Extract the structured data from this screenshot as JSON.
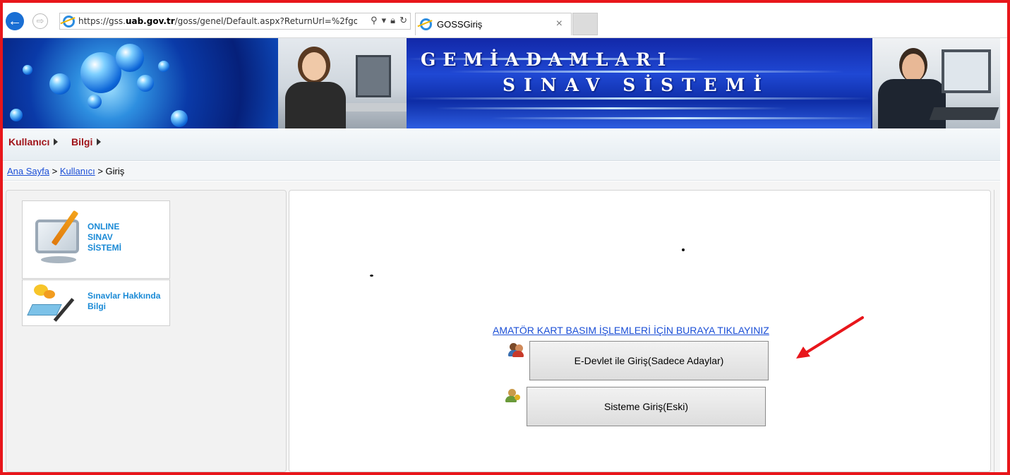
{
  "browser": {
    "url_prefix": "https://gss.",
    "url_domain": "uab.gov.tr",
    "url_suffix": "/goss/genel/Default.aspx?ReturnUrl=%2fgo",
    "tab_title": "GOSSGiriş",
    "tab_close": "×"
  },
  "banner": {
    "title_line1": "GEMİADAMLARI",
    "title_line2": "SINAV SİSTEMİ"
  },
  "menu": {
    "items": [
      {
        "label": "Kullanıcı"
      },
      {
        "label": "Bilgi"
      }
    ]
  },
  "breadcrumb": {
    "home": "Ana Sayfa",
    "sep1": " > ",
    "user": "Kullanıcı",
    "sep2": " > ",
    "current": "Giriş"
  },
  "sidebar": {
    "tile1_line1": "ONLINE",
    "tile1_line2": "SINAV",
    "tile1_line3": "SİSTEMİ",
    "tile2_line1": "Sınavlar Hakkında",
    "tile2_line2": "Bilgi"
  },
  "main": {
    "amator_link": "AMATÖR KART BASIM İŞLEMLERİ İÇİN BURAYA TIKLAYINIZ",
    "edevlet_button": "E-Devlet ile Giriş(Sadece Adaylar)",
    "sisteme_button": "Sisteme Giriş(Eski)"
  },
  "colors": {
    "frame": "#e8161b",
    "menu_text": "#a0141a",
    "link": "#1a4ed6",
    "tile_text": "#1a8ad6"
  }
}
